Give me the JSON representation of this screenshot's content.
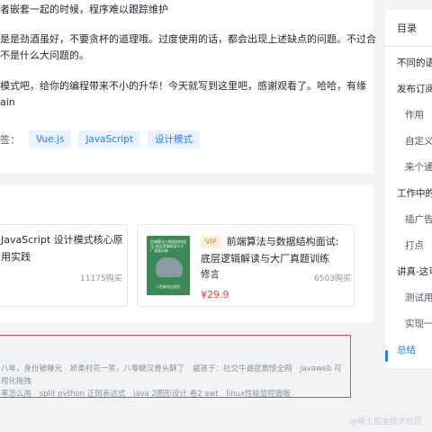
{
  "article": {
    "lines": [
      "者嵌套一起的时候，程序难以跟踪维护",
      "是是劲酒虽好，不要贪杯的道理哦。过度使用的话，都会出现上述缺点的问题。不过合",
      "不是什么大问题的。",
      "模式吧，给你的编程带来不小的升华！今天就写到这里吧，感谢观看了。哈哈，有缘",
      "ain"
    ],
    "tags_label": "签：",
    "tags": [
      "Vue.js",
      "JavaScript",
      "设计模式"
    ]
  },
  "books": {
    "left": {
      "title": "JavaScript 设计模式核心原",
      "subtitle": "用实践",
      "buyers": "11175购买"
    },
    "right": {
      "vip": "VIP",
      "title_line1": "前端算法与数据结构面试:",
      "title_line2": "底层逻辑解读与大厂真题训练",
      "author": "修言",
      "buyers": "6503购买",
      "price": "¥29.9",
      "cover_title": "前端算法与数据结构面试 底层逻辑解读与大厂真题训练",
      "cover_foot": "人民邮电出版社"
    }
  },
  "related_links": {
    "line1": [
      "八年，身份被曝光",
      "娇柔村花一笑，八零糙汉骨头酥了",
      "戚孩子：社交牛逼症震惊全网",
      "javaweb 可视化拖拽"
    ],
    "line2": [
      "率怎么用",
      "split python 正则表达式",
      "java 2图形设计 卷2 awt",
      "linux性能监控面板"
    ]
  },
  "toc": {
    "title": "目录",
    "items": [
      {
        "label": "不同的语",
        "level": 1
      },
      {
        "label": "发布订阅",
        "level": 1
      },
      {
        "label": "作用",
        "level": 2
      },
      {
        "label": "自定义",
        "level": 2
      },
      {
        "label": "来个通",
        "level": 2
      },
      {
        "label": "工作中的",
        "level": 1
      },
      {
        "label": "插广告",
        "level": 2
      },
      {
        "label": "打点",
        "level": 2
      },
      {
        "label": "讲真-这可",
        "level": 1
      },
      {
        "label": "测试用",
        "level": 2
      },
      {
        "label": "实现一",
        "level": 2
      },
      {
        "label": "总结",
        "level": 1,
        "active": true
      }
    ]
  },
  "watermark": "@稀土掘金技术社区",
  "colors": {
    "accent": "#1e80ff",
    "price": "#f53f3f",
    "highlight_border": "#e14b4b",
    "background": "#f2f3f5"
  }
}
